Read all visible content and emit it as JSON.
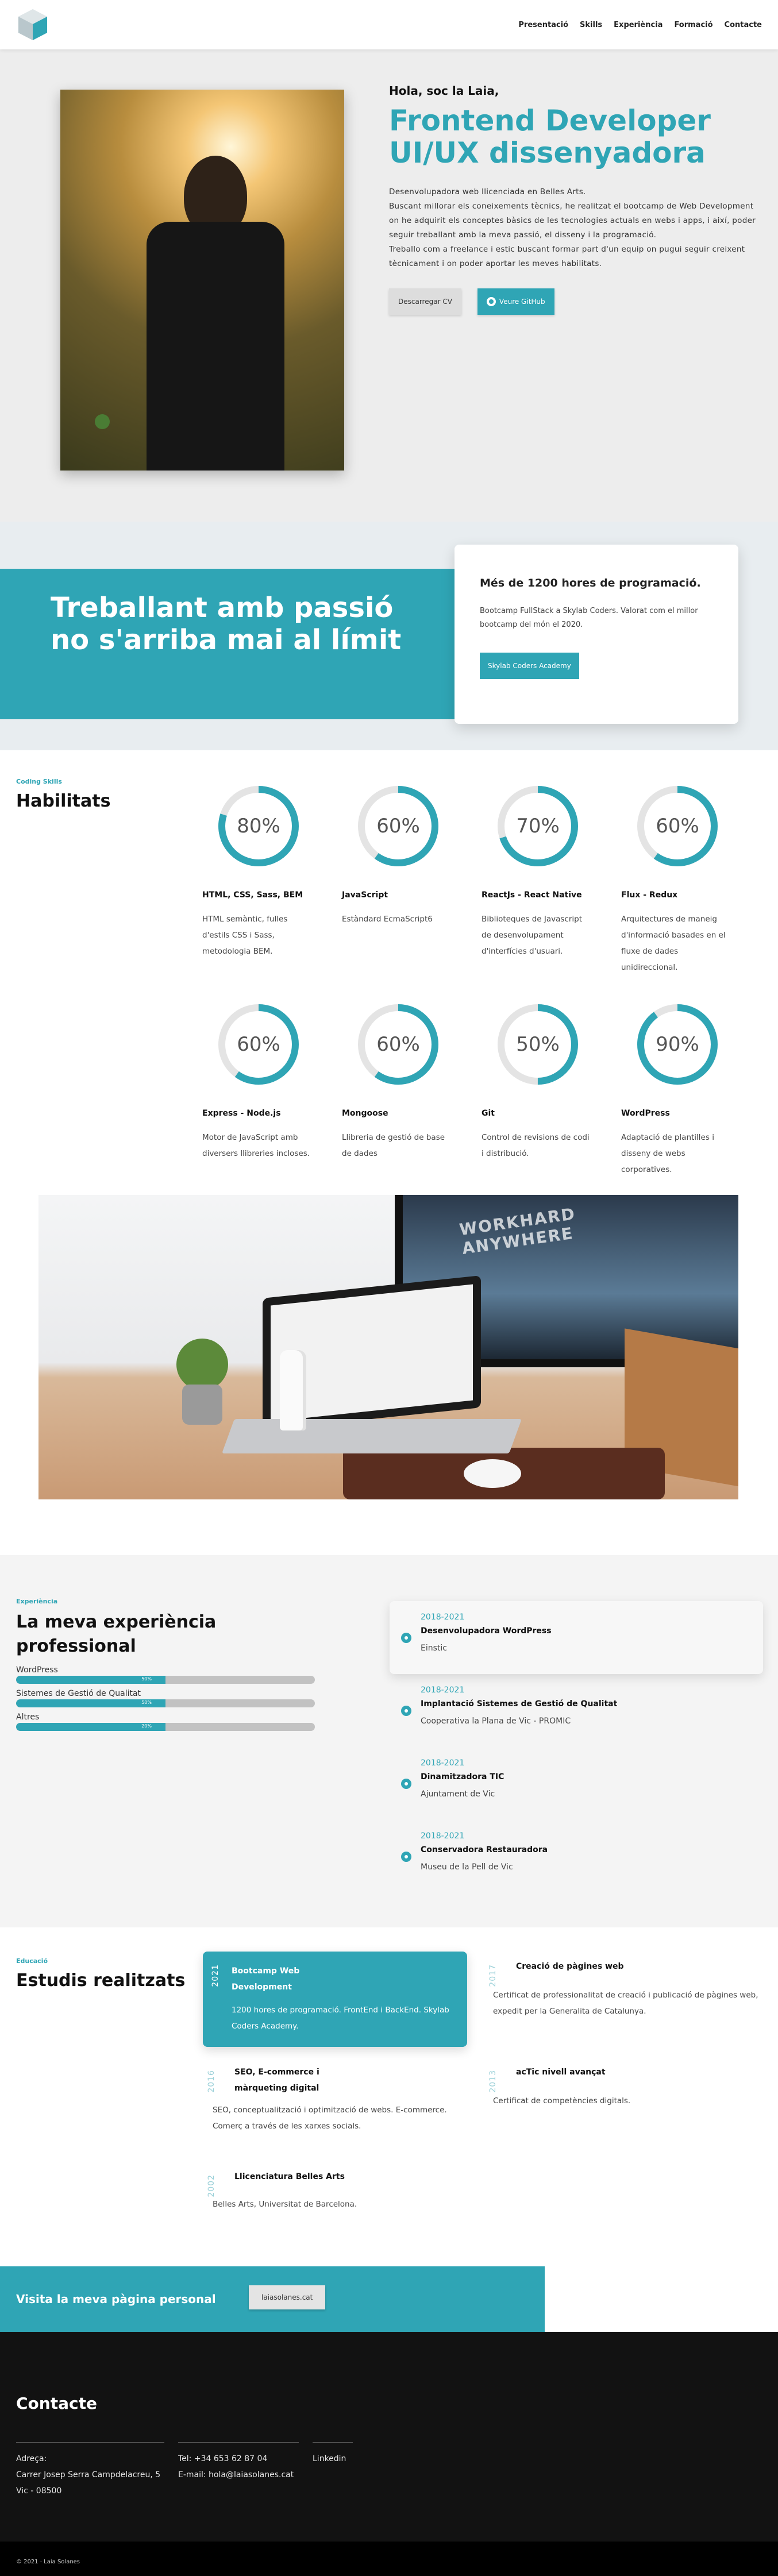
{
  "nav": {
    "items": [
      "Presentació",
      "Skills",
      "Experiència",
      "Formació",
      "Contacte"
    ]
  },
  "hero": {
    "hello": "Hola, soc la Laia,",
    "title_line1": "Frontend Developer",
    "title_line2": "UI/UX dissenyadora",
    "desc_line1": "Desenvolupadora web llicenciada en Belles Arts.",
    "desc_line2": "Buscant millorar els coneixements tècnics, he realitzat el bootcamp de Web Development on he adquirit els conceptes bàsics de les tecnologies actuals en webs i apps, i així, poder seguir treballant amb la meva passió, el disseny i la programació.",
    "desc_line3": "Treballo com a freelance i estic buscant formar part d'un equip on pugui seguir creixent tècnicament i on poder aportar les meves habilitats.",
    "btn_cv": "Descarregar CV",
    "btn_github": "Veure GitHub"
  },
  "passion": {
    "title_line1": "Treballant amb passió",
    "title_line2": "no s'arriba mai al límit",
    "card_title": "Més de 1200 hores de programació.",
    "card_text": "Bootcamp FullStack a Skylab Coders. Valorat com el millor bootcamp del món el 2020.",
    "card_button": "Skylab Coders Academy"
  },
  "skills": {
    "tag": "Coding Skills",
    "title": "Habilitats",
    "items": [
      {
        "percent": 80,
        "label": "80%",
        "name": "HTML, CSS, Sass, BEM",
        "desc": "HTML semàntic, fulles d'estils CSS i Sass, metodologia BEM."
      },
      {
        "percent": 60,
        "label": "60%",
        "name": "JavaScript",
        "desc": "Estàndard EcmaScript6"
      },
      {
        "percent": 70,
        "label": "70%",
        "name": "ReactJs - React Native",
        "desc": "Biblioteques de Javascript de desenvolupament d'interfícies d'usuari."
      },
      {
        "percent": 60,
        "label": "60%",
        "name": "Flux - Redux",
        "desc": "Arquitectures de maneig d'informació basades en el fluxe de dades unidireccional."
      },
      {
        "percent": 60,
        "label": "60%",
        "name": "Express - Node.js",
        "desc": "Motor de JavaScript amb diversers llibreries incloses."
      },
      {
        "percent": 60,
        "label": "60%",
        "name": "Mongoose",
        "desc": "Llibreria de gestió de base de dades"
      },
      {
        "percent": 50,
        "label": "50%",
        "name": "Git",
        "desc": "Control de revisions de codi i distribució."
      },
      {
        "percent": 90,
        "label": "90%",
        "name": "WordPress",
        "desc": "Adaptació de plantilles i disseny de webs corporatives."
      }
    ]
  },
  "desk": {
    "monitor_text_line1": "WORKHARD",
    "monitor_text_line2": "ANYWHERE"
  },
  "experience": {
    "tag": "Experiència",
    "title": "La meva experiència professional",
    "bars": [
      {
        "label": "WordPress",
        "value": 50,
        "value_label": "50%"
      },
      {
        "label": "Sistemes de Gestió de Qualitat",
        "value": 50,
        "value_label": "50%"
      },
      {
        "label": "Altres",
        "value": 50,
        "value_label": "20%"
      }
    ],
    "timeline": [
      {
        "date": "2018-2021",
        "title": "Desenvolupadora WordPress",
        "sub": "Einstic"
      },
      {
        "date": "2018-2021",
        "title": "Implantació Sistemes de Gestió de Qualitat",
        "sub": "Cooperativa la Plana de Vic - PROMIC"
      },
      {
        "date": "2018-2021",
        "title": "Dinamitzadora TIC",
        "sub": "Ajuntament de Vic"
      },
      {
        "date": "2018-2021",
        "title": "Conservadora Restauradora",
        "sub": "Museu de la Pell de Vic"
      }
    ]
  },
  "education": {
    "tag": "Educació",
    "title": "Estudis realitzats",
    "items": [
      {
        "year": "2021",
        "title": "Bootcamp Web Development",
        "text": "1200 hores de programació. FrontEnd i BackEnd. Skylab Coders Academy."
      },
      {
        "year": "2017",
        "title": "Creació de pàgines web",
        "text": "Certificat de professionalitat de creació i publicació de pàgines web, expedit per la Generalita de Catalunya."
      },
      {
        "year": "2016",
        "title": "SEO, E-commerce i màrqueting digital",
        "text": "SEO, conceptualització i optimització de webs. E-commerce. Comerç a través de les xarxes socials."
      },
      {
        "year": "2013",
        "title": "acTic nivell avançat",
        "text": "Certificat de competències digitals."
      },
      {
        "year": "2002",
        "title": "Llicenciatura Belles Arts",
        "text": "Belles Arts, Universitat de Barcelona."
      }
    ]
  },
  "visit": {
    "text": "Visita la meva pàgina personal",
    "button": "laiasolanes.cat"
  },
  "contact": {
    "title": "Contacte",
    "address_label": "Adreça:",
    "address_line1": "Carrer Josep Serra Campdelacreu, 5",
    "address_line2": "Vic - 08500",
    "phone": "Tel: +34 653 62 87 04",
    "email": "E-mail: hola@laiasolanes.cat",
    "linkedin": "Linkedin"
  },
  "footer": {
    "copyright": "© 2021 · Laia Solanes"
  },
  "colors": {
    "accent": "#2fa5b5",
    "dark": "#121212"
  }
}
